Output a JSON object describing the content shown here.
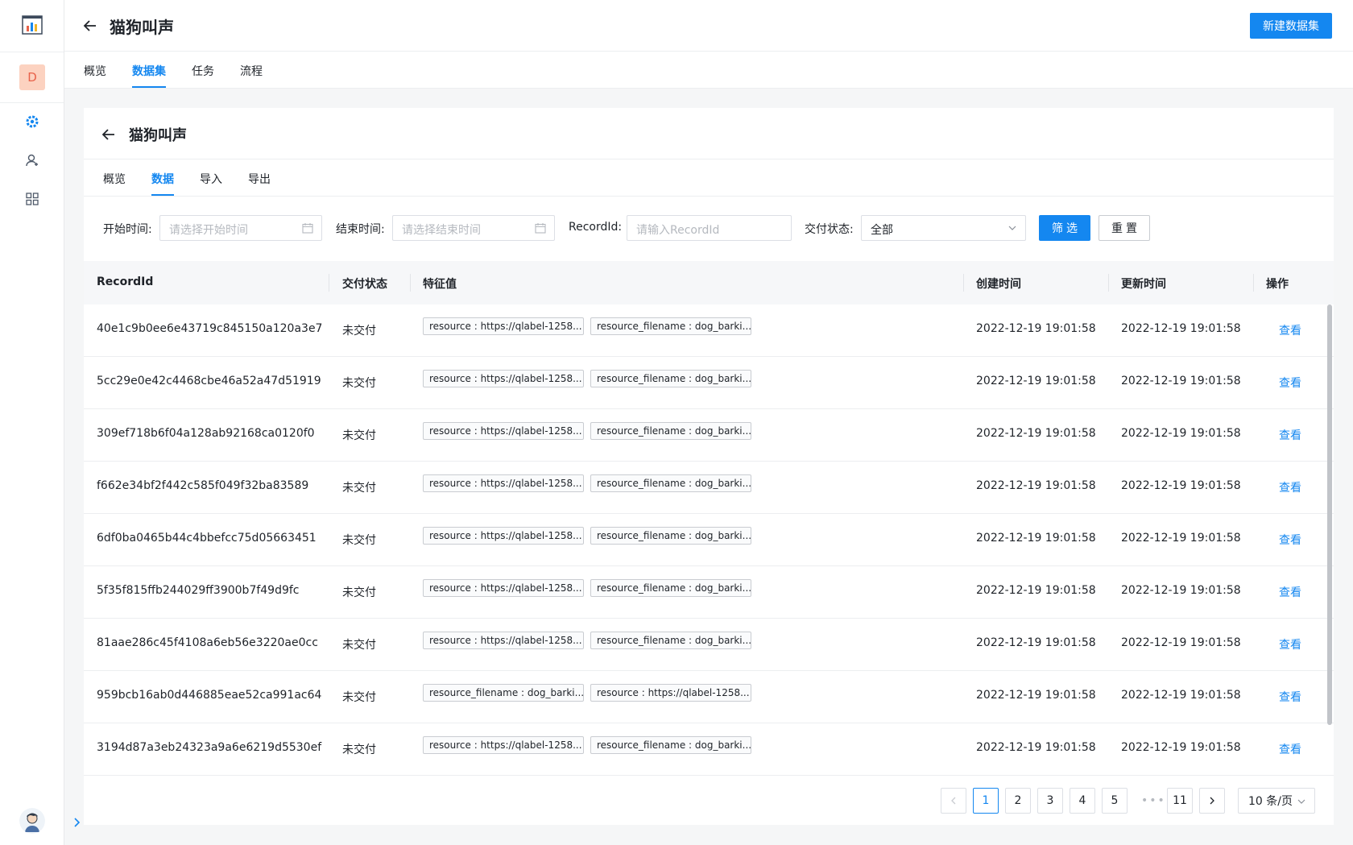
{
  "header": {
    "title": "猫狗叫声",
    "primary_button": "新建数据集"
  },
  "sidebar": {
    "avatar_letter": "D"
  },
  "main_tabs": [
    {
      "label": "概览",
      "active": false
    },
    {
      "label": "数据集",
      "active": true
    },
    {
      "label": "任务",
      "active": false
    },
    {
      "label": "流程",
      "active": false
    }
  ],
  "dataset": {
    "title": "猫狗叫声",
    "tabs": [
      {
        "label": "概览",
        "active": false
      },
      {
        "label": "数据",
        "active": true
      },
      {
        "label": "导入",
        "active": false
      },
      {
        "label": "导出",
        "active": false
      }
    ]
  },
  "filters": {
    "start_label": "开始时间:",
    "start_placeholder": "请选择开始时间",
    "end_label": "结束时间:",
    "end_placeholder": "请选择结束时间",
    "record_label": "RecordId:",
    "record_placeholder": "请输入RecordId",
    "status_label": "交付状态:",
    "status_value": "全部",
    "filter_button": "筛选",
    "reset_button": "重置"
  },
  "table": {
    "columns": [
      "RecordId",
      "交付状态",
      "特征值",
      "创建时间",
      "更新时间",
      "操作"
    ],
    "action_label": "查看",
    "rows": [
      {
        "id": "40e1c9b0ee6e43719c845150a120a3e7",
        "status": "未交付",
        "tags": [
          "resource : https://qlabel-1258...",
          "resource_filename : dog_barki..."
        ],
        "created": "2022-12-19 19:01:58",
        "updated": "2022-12-19 19:01:58"
      },
      {
        "id": "5cc29e0e42c4468cbe46a52a47d51919",
        "status": "未交付",
        "tags": [
          "resource : https://qlabel-1258...",
          "resource_filename : dog_barki..."
        ],
        "created": "2022-12-19 19:01:58",
        "updated": "2022-12-19 19:01:58"
      },
      {
        "id": "309ef718b6f04a128ab92168ca0120f0",
        "status": "未交付",
        "tags": [
          "resource : https://qlabel-1258...",
          "resource_filename : dog_barki..."
        ],
        "created": "2022-12-19 19:01:58",
        "updated": "2022-12-19 19:01:58"
      },
      {
        "id": "f662e34bf2f442c585f049f32ba83589",
        "status": "未交付",
        "tags": [
          "resource : https://qlabel-1258...",
          "resource_filename : dog_barki..."
        ],
        "created": "2022-12-19 19:01:58",
        "updated": "2022-12-19 19:01:58"
      },
      {
        "id": "6df0ba0465b44c4bbefcc75d05663451",
        "status": "未交付",
        "tags": [
          "resource : https://qlabel-1258...",
          "resource_filename : dog_barki..."
        ],
        "created": "2022-12-19 19:01:58",
        "updated": "2022-12-19 19:01:58"
      },
      {
        "id": "5f35f815ffb244029ff3900b7f49d9fc",
        "status": "未交付",
        "tags": [
          "resource : https://qlabel-1258...",
          "resource_filename : dog_barki..."
        ],
        "created": "2022-12-19 19:01:58",
        "updated": "2022-12-19 19:01:58"
      },
      {
        "id": "81aae286c45f4108a6eb56e3220ae0cc",
        "status": "未交付",
        "tags": [
          "resource : https://qlabel-1258...",
          "resource_filename : dog_barki..."
        ],
        "created": "2022-12-19 19:01:58",
        "updated": "2022-12-19 19:01:58"
      },
      {
        "id": "959bcb16ab0d446885eae52ca991ac64",
        "status": "未交付",
        "tags": [
          "resource_filename : dog_barki...",
          "resource : https://qlabel-1258..."
        ],
        "created": "2022-12-19 19:01:58",
        "updated": "2022-12-19 19:01:58"
      },
      {
        "id": "3194d87a3eb24323a9a6e6219d5530ef",
        "status": "未交付",
        "tags": [
          "resource : https://qlabel-1258...",
          "resource_filename : dog_barki..."
        ],
        "created": "2022-12-19 19:01:58",
        "updated": "2022-12-19 19:01:58"
      }
    ]
  },
  "pagination": {
    "pages": [
      "1",
      "2",
      "3",
      "4",
      "5"
    ],
    "current": "1",
    "dots": "•••",
    "last": "11",
    "page_size": "10 条/页"
  },
  "colors": {
    "primary": "#1487f0",
    "avatar_bg": "#fcd2c0",
    "avatar_text": "#e8624a"
  }
}
